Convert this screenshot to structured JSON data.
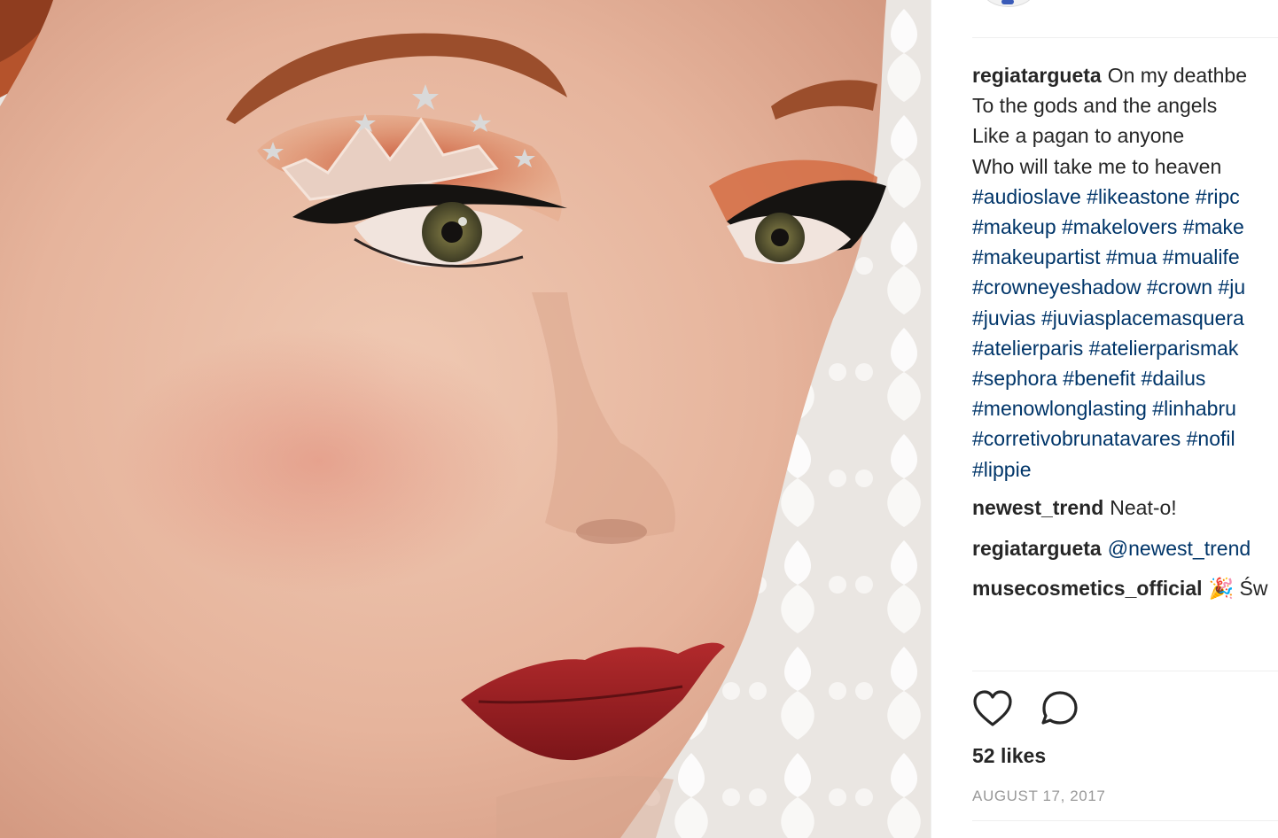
{
  "post": {
    "author": "regiatargueta",
    "caption_lines": [
      "On my deathbe",
      "To the gods and the angels",
      "Like a pagan to anyone",
      "Who will take me to heaven"
    ],
    "hashtag_lines": [
      "#audioslave #likeastone #ripc",
      "#makeup #makelovers #make",
      "#makeupartist #mua #mualife",
      "#crowneyeshadow #crown #ju",
      "#juvias #juviasplacemasquera",
      "#atelierparis #atelierparismak",
      "#sephora #benefit #dailus",
      "#menowlonglasting #linhabru",
      "#corretivobrunatavares #nofil",
      "#lippie"
    ]
  },
  "comments": [
    {
      "user": "newest_trend",
      "text": "Neat-o!"
    },
    {
      "user": "regiatargueta",
      "text": "@newest_trend"
    },
    {
      "user": "musecosmetics_official",
      "text": "🎉 Św"
    }
  ],
  "actions": {
    "like_icon": "heart-icon",
    "comment_icon": "comment-icon"
  },
  "likes": "52 likes",
  "date": "AUGUST 17, 2017",
  "colors": {
    "link": "#003569",
    "text": "#262626",
    "muted": "#999999",
    "lip": "#9c1f24",
    "eyeshadow": "#c8583a"
  }
}
